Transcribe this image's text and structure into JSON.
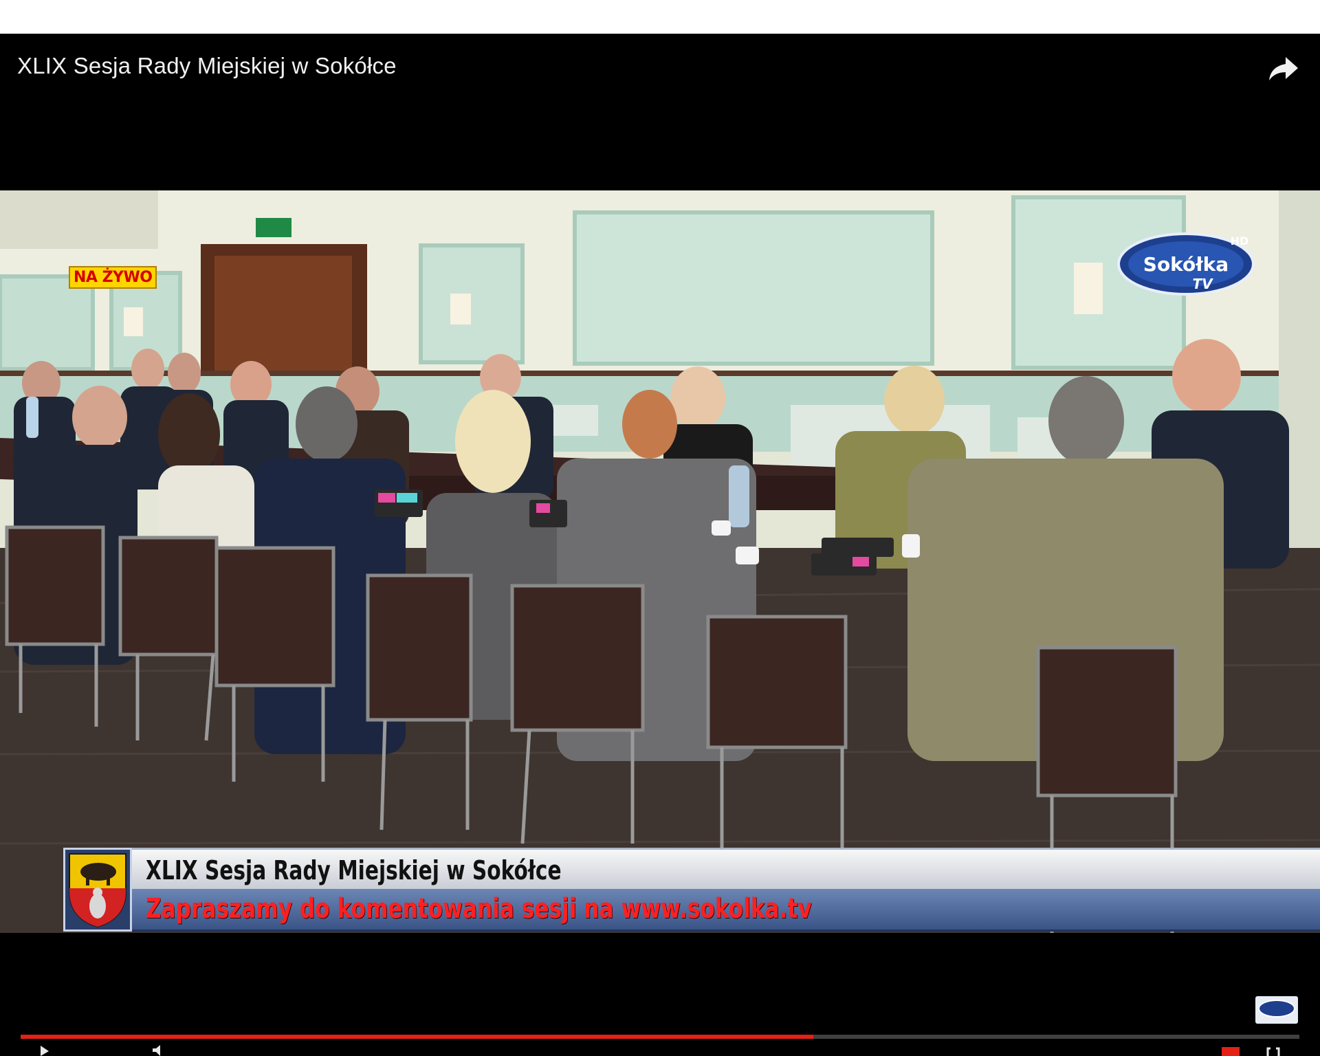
{
  "player": {
    "title": "XLIX Sesja Rady Miejskiej w Sokółce",
    "share_icon": "share-arrow-icon"
  },
  "overlay": {
    "live_badge": "NA ŻYWO",
    "channel_logo": {
      "text_main": "Sokółka",
      "text_sub": "TV",
      "text_hd": "HD"
    }
  },
  "lower_third": {
    "line1": "XLIX Sesja Rady Miejskiej w Sokółce",
    "line2": "Zapraszamy do komentowania sesji na www.sokolka.tv"
  },
  "progress": {
    "played_fraction": 0.62,
    "loaded_fraction": 0.62
  },
  "colors": {
    "progress_played": "#e52117",
    "live_badge_bg": "#ffd400",
    "live_badge_text": "#d40000",
    "lower_third_red": "#ff2020"
  }
}
